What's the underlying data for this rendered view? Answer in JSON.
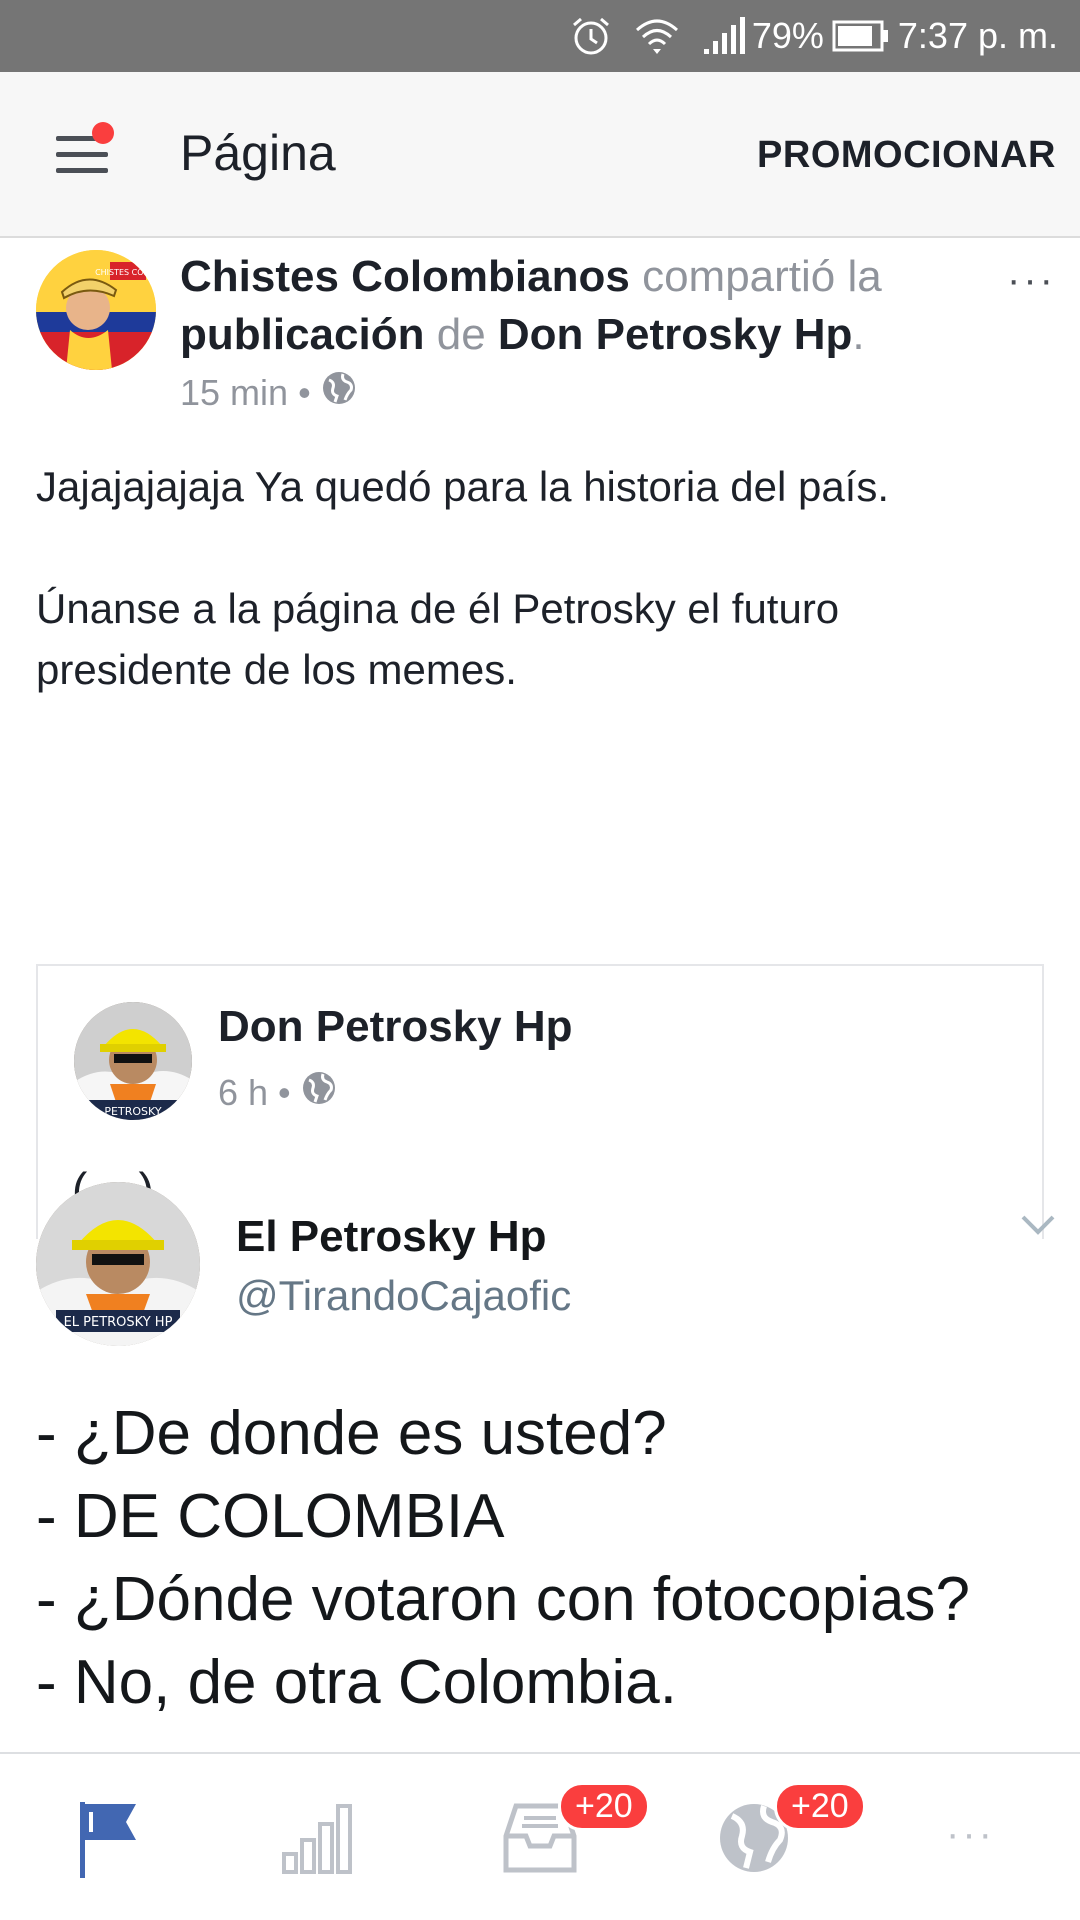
{
  "status_bar": {
    "battery": "79%",
    "time": "7:37 p. m."
  },
  "app_bar": {
    "title": "Página",
    "action": "PROMOCIONAR"
  },
  "post": {
    "author": "Chistes Colombianos",
    "shared_text": "compartió la",
    "object": "publicación",
    "connector": "de",
    "source": "Don Petrosky Hp",
    "period": ".",
    "time": "15 min",
    "separator": "•",
    "more": "···",
    "text_line1": "Jajajajajaja Ya quedó para la historia del país.",
    "text_line2": "Únanse a la página de él Petrosky el futuro presidente de los memes."
  },
  "shared_post": {
    "name": "Don Petrosky Hp",
    "time": "6 h",
    "separator": "•",
    "text": "(._.)"
  },
  "tweet": {
    "name": "El Petrosky Hp",
    "handle": "@TirandoCajaofic",
    "avatar_caption": "EL PETROSKY HP",
    "lines": [
      "- ¿De donde es usted?",
      "- DE COLOMBIA",
      "- ¿Dónde votaron con fotocopias?",
      "- No, de otra Colombia."
    ]
  },
  "page_avatar_caption": "CHISTES COLOM",
  "shared_avatar_caption": "PETROSKY",
  "bottom_nav": {
    "inbox_badge": "+20",
    "notifications_badge": "+20",
    "more": "···"
  },
  "colors": {
    "accent": "#4267b2",
    "badge": "#fa3e3e",
    "status_bar": "#757575"
  }
}
